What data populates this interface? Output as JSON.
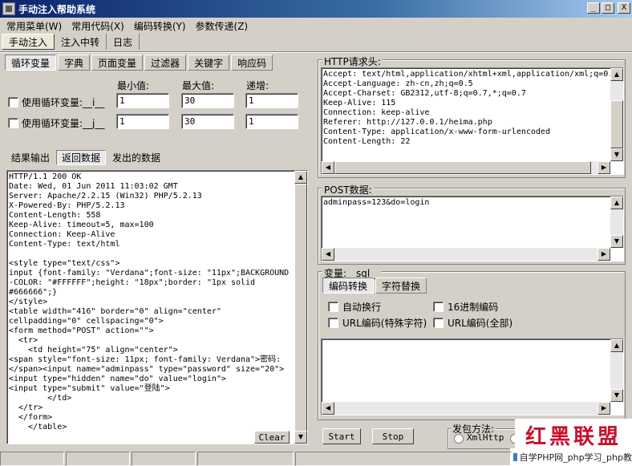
{
  "window": {
    "title": "手动注入帮助系统",
    "controls": {
      "minimize": "_",
      "maximize": "□",
      "close": "X"
    }
  },
  "menubar": [
    {
      "label": "常用菜单(W)"
    },
    {
      "label": "常用代码(X)"
    },
    {
      "label": "编码转换(Y)"
    },
    {
      "label": "参数传递(Z)"
    }
  ],
  "top_tabs": [
    {
      "label": "手动注入",
      "active": true
    },
    {
      "label": "注入中转",
      "active": false
    },
    {
      "label": "日志",
      "active": false
    }
  ],
  "loop_tabs": [
    {
      "label": "循环变量",
      "active": true
    },
    {
      "label": "字典",
      "active": false
    },
    {
      "label": "页面变量",
      "active": false
    },
    {
      "label": "过滤器",
      "active": false
    },
    {
      "label": "关键字",
      "active": false
    },
    {
      "label": "响应码",
      "active": false
    }
  ],
  "loop_vars": {
    "min_label": "最小值:",
    "max_label": "最大值:",
    "step_label": "递增:",
    "rows": [
      {
        "label": "使用循环变量:__i__",
        "min": "1",
        "max": "30",
        "step": "1"
      },
      {
        "label": "使用循环变量:__j__",
        "min": "1",
        "max": "30",
        "step": "1"
      }
    ]
  },
  "result_tabs": [
    {
      "label": "结果输出",
      "active": false
    },
    {
      "label": "返回数据",
      "active": true
    },
    {
      "label": "发出的数据",
      "active": false
    }
  ],
  "response_text": "HTTP/1.1 200 OK\nDate: Wed, 01 Jun 2011 11:03:02 GMT\nServer: Apache/2.2.15 (Win32) PHP/5.2.13\nX-Powered-By: PHP/5.2.13\nContent-Length: 558\nKeep-Alive: timeout=5, max=100\nConnection: Keep-Alive\nContent-Type: text/html\n\n<style type=\"text/css\">\ninput {font-family: \"Verdana\";font-size: \"11px\";BACKGROUND\n-COLOR: \"#FFFFFF\";height: \"18px\";border: \"1px solid\n#666666\";}\n</style>\n<table width=\"416\" border=\"0\" align=\"center\"\ncellpadding=\"0\" cellspacing=\"0\">\n<form method=\"POST\" action=\"\">\n  <tr>\n    <td height=\"75\" align=\"center\">\n<span style=\"font-size: 11px; font-family: Verdana\">密码:\n</span><input name=\"adminpass\" type=\"password\" size=\"20\">\n<input type=\"hidden\" name=\"do\" value=\"login\">\n<input type=\"submit\" value=\"登陆\">\n        </td>\n  </tr>\n  </form>\n    </table>",
  "clear_label": "Clear",
  "http_headers": {
    "title": "HTTP请求头:",
    "text": "Accept: text/html,application/xhtml+xml,application/xml;q=0.\nAccept-Language: zh-cn,zh;q=0.5\nAccept-Charset: GB2312,utf-8;q=0.7,*;q=0.7\nKeep-Alive: 115\nConnection: keep-alive\nReferer: http://127.0.0.1/heima.php\nContent-Type: application/x-www-form-urlencoded\nContent-Length: 22"
  },
  "post_data": {
    "title": "POST数据:",
    "text": "adminpass=123&do=login"
  },
  "variable": {
    "title": "变量:__sql__",
    "tabs": [
      {
        "label": "编码转换",
        "active": true
      },
      {
        "label": "字符替换",
        "active": false
      }
    ],
    "options": [
      {
        "label": "自动换行"
      },
      {
        "label": "16进制编码"
      },
      {
        "label": "URL编码(特殊字符)"
      },
      {
        "label": "URL编码(全部)"
      }
    ]
  },
  "actions": {
    "start": "Start",
    "stop": "Stop"
  },
  "send_method": {
    "title": "发包方法:",
    "option1": "XmlHttp"
  },
  "watermark": {
    "text": "红黑联盟"
  },
  "footer_link": "自学PHP网_php学习_php教"
}
